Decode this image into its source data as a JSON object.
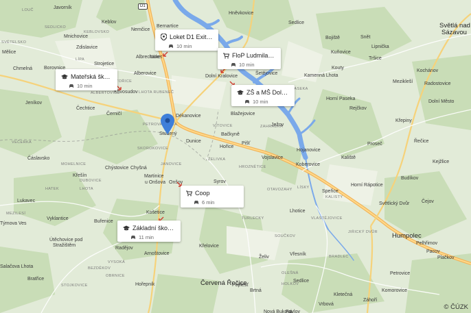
{
  "places": [
    {
      "text": "Javorník",
      "cls": ""
    },
    {
      "text": "Keblov",
      "cls": ""
    },
    {
      "text": "Mnichovice",
      "cls": ""
    },
    {
      "text": "Mělice",
      "cls": ""
    },
    {
      "text": "Chmelná",
      "cls": ""
    },
    {
      "text": "Borovnice",
      "cls": ""
    },
    {
      "text": "Zdislavice",
      "cls": ""
    },
    {
      "text": "Strojetice",
      "cls": ""
    },
    {
      "text": "Nemčice",
      "cls": ""
    },
    {
      "text": "Bernartice",
      "cls": ""
    },
    {
      "text": "Loket",
      "cls": ""
    },
    {
      "text": "Albrechtice",
      "cls": ""
    },
    {
      "text": "Alberovice",
      "cls": ""
    },
    {
      "text": "Khvosudov",
      "cls": ""
    },
    {
      "text": "Jeníkov",
      "cls": ""
    },
    {
      "text": "Čechtice",
      "cls": ""
    },
    {
      "text": "Černičí",
      "cls": ""
    },
    {
      "text": "Dékanovice",
      "cls": ""
    },
    {
      "text": "Studený",
      "cls": ""
    },
    {
      "text": "Dunice",
      "cls": ""
    },
    {
      "text": "Hořice",
      "cls": ""
    },
    {
      "text": "Bačkyně",
      "cls": ""
    },
    {
      "text": "Blažejovice",
      "cls": ""
    },
    {
      "text": "Pišť",
      "cls": ""
    },
    {
      "text": "Ježov",
      "cls": ""
    },
    {
      "text": "Dolní Kralovice",
      "cls": ""
    },
    {
      "text": "Šetějovice",
      "cls": ""
    },
    {
      "text": "Hněvkovice",
      "cls": ""
    },
    {
      "text": "Sedlice",
      "cls": ""
    },
    {
      "text": "Bojiště",
      "cls": ""
    },
    {
      "text": "Kuňovice",
      "cls": ""
    },
    {
      "text": "Snět",
      "cls": ""
    },
    {
      "text": "Kamenná Lhota",
      "cls": ""
    },
    {
      "text": "Kouty",
      "cls": ""
    },
    {
      "text": "Horní Paseka",
      "cls": ""
    },
    {
      "text": "Rejčkov",
      "cls": ""
    },
    {
      "text": "Světlá nad",
      "cls": "big"
    },
    {
      "text": "Sázavou",
      "cls": "big"
    },
    {
      "text": "Lipnička",
      "cls": ""
    },
    {
      "text": "Tršice",
      "cls": ""
    },
    {
      "text": "Kochánov",
      "cls": ""
    },
    {
      "text": "Mezikleší",
      "cls": ""
    },
    {
      "text": "Radostovice",
      "cls": ""
    },
    {
      "text": "Dolní Město",
      "cls": ""
    },
    {
      "text": "Křepiny",
      "cls": ""
    },
    {
      "text": "Hojanovice",
      "cls": ""
    },
    {
      "text": "Vojslavice",
      "cls": ""
    },
    {
      "text": "Koberovice",
      "cls": ""
    },
    {
      "text": "Kaliště",
      "cls": ""
    },
    {
      "text": "Proseč",
      "cls": ""
    },
    {
      "text": "Řečice",
      "cls": ""
    },
    {
      "text": "Kejžlice",
      "cls": ""
    },
    {
      "text": "Budíkov",
      "cls": ""
    },
    {
      "text": "Horní Rápotice",
      "cls": ""
    },
    {
      "text": "Světlický Dvůr",
      "cls": ""
    },
    {
      "text": "Čejov",
      "cls": ""
    },
    {
      "text": "Speřice",
      "cls": ""
    },
    {
      "text": "Čáslavsko",
      "cls": ""
    },
    {
      "text": "Křešín",
      "cls": ""
    },
    {
      "text": "Chýstovice",
      "cls": ""
    },
    {
      "text": "Chyšná",
      "cls": ""
    },
    {
      "text": "Martinice",
      "cls": ""
    },
    {
      "text": "u Onšova",
      "cls": ""
    },
    {
      "text": "Onšov",
      "cls": ""
    },
    {
      "text": "Syrov",
      "cls": ""
    },
    {
      "text": "Lukavec",
      "cls": ""
    },
    {
      "text": "Týmova Ves",
      "cls": ""
    },
    {
      "text": "Vyklantice",
      "cls": ""
    },
    {
      "text": "Buřenice",
      "cls": ""
    },
    {
      "text": "Košetice",
      "cls": ""
    },
    {
      "text": "Lhotice",
      "cls": ""
    },
    {
      "text": "Útěchovice pod",
      "cls": ""
    },
    {
      "text": "Stražištěm",
      "cls": ""
    },
    {
      "text": "Radějov",
      "cls": ""
    },
    {
      "text": "Křelovice",
      "cls": ""
    },
    {
      "text": "Arnoštovice",
      "cls": ""
    },
    {
      "text": "Salačova Lhota",
      "cls": ""
    },
    {
      "text": "Bratřice",
      "cls": ""
    },
    {
      "text": "Hořepník",
      "cls": ""
    },
    {
      "text": "Červená Řečice",
      "cls": "big"
    },
    {
      "text": "Humpolec",
      "cls": "big"
    },
    {
      "text": "Vřesník",
      "cls": ""
    },
    {
      "text": "Želiv",
      "cls": ""
    },
    {
      "text": "Pelhřimov",
      "cls": ""
    },
    {
      "text": "Kletečná",
      "cls": ""
    },
    {
      "text": "Záhoří",
      "cls": ""
    },
    {
      "text": "Komorovice",
      "cls": ""
    },
    {
      "text": "Petrovice",
      "cls": ""
    },
    {
      "text": "Pacov",
      "cls": ""
    },
    {
      "text": "Plačkov",
      "cls": ""
    },
    {
      "text": "Vrbová",
      "cls": ""
    },
    {
      "text": "Poplešť",
      "cls": ""
    },
    {
      "text": "Brtná",
      "cls": ""
    },
    {
      "text": "Nová Buková",
      "cls": ""
    },
    {
      "text": "Pavlov",
      "cls": ""
    },
    {
      "text": "Sedlice",
      "cls": ""
    }
  ],
  "regions": [
    {
      "text": "LOUČ"
    },
    {
      "text": "SEDLICKO"
    },
    {
      "text": "KEBLOVSKO"
    },
    {
      "text": "SVĚTELSKO"
    },
    {
      "text": "LÍPA"
    },
    {
      "text": "ŠTOŘICE"
    },
    {
      "text": "LHOTA RUBENEČ"
    },
    {
      "text": "ALBERTOVICE"
    },
    {
      "text": "PETROVA LHOTA"
    },
    {
      "text": "SKOROKOVICE"
    },
    {
      "text": "JANOVICE"
    },
    {
      "text": "VÍTOVICE"
    },
    {
      "text": "DOLNÍ PASEKA"
    },
    {
      "text": "ZAHRÁDKA"
    },
    {
      "text": "HROZNĚTICE"
    },
    {
      "text": "MOHELNICE"
    },
    {
      "text": "ŽELIVKA"
    },
    {
      "text": "OTAVOZAHY"
    },
    {
      "text": "LÍSKY"
    },
    {
      "text": "KALISTY"
    },
    {
      "text": "VLASTĚJOVICE"
    },
    {
      "text": "TURLECKY"
    },
    {
      "text": "JIŘICKÝ DVŮR"
    },
    {
      "text": "BRADLEC"
    },
    {
      "text": "OLEŠNÁ"
    },
    {
      "text": "OBRNICE"
    },
    {
      "text": "LHOTA"
    },
    {
      "text": "VEČERKA"
    },
    {
      "text": "DUBOVICE"
    },
    {
      "text": "HATEK"
    },
    {
      "text": "MEZILESÍ"
    },
    {
      "text": "SOUČKOV"
    },
    {
      "text": "BEZDĚKOV"
    },
    {
      "text": "STOJKOVICE"
    },
    {
      "text": "VYSOKÁ"
    },
    {
      "text": "HOLKOV"
    }
  ],
  "roads": [
    {
      "text": "D1"
    }
  ],
  "pin": {
    "name": "Studený",
    "color": "#3f7fd9"
  },
  "cards": [
    {
      "title": "Loket D1 Exit 66",
      "time": "10 min",
      "icon": "location-pin-icon"
    },
    {
      "title": "FloP Ludmila Bur...",
      "time": "10 min",
      "icon": "shopping-cart-icon"
    },
    {
      "title": "Mateřská škola",
      "time": "10 min",
      "icon": "school-icon"
    },
    {
      "title": "ZŠ a MŠ Dolní Kra...",
      "time": "10 min",
      "icon": "school-icon"
    },
    {
      "title": "Coop",
      "time": "6 min",
      "icon": "shopping-cart-icon"
    },
    {
      "title": "Základní škola a ...",
      "time": "11 min",
      "icon": "school-icon"
    }
  ],
  "copyright": "© ČÚZK",
  "colors": {
    "forest": "#c6dcb4",
    "field": "#e6edd9",
    "water": "#79a8e8",
    "road_major": "#f5c46b",
    "road_minor": "#ffffff",
    "arrow": "#d23c2f",
    "pin": "#3f7fd9"
  }
}
